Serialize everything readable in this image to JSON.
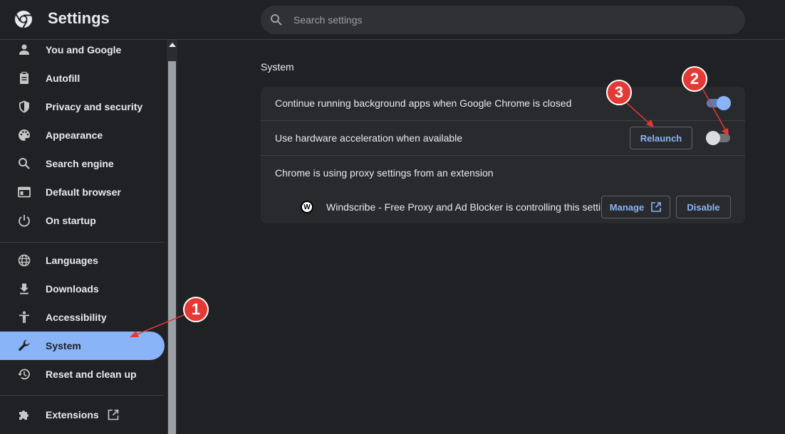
{
  "header": {
    "title": "Settings",
    "search_placeholder": "Search settings"
  },
  "sidebar": {
    "items": [
      {
        "label": "You and Google",
        "icon": "person-icon"
      },
      {
        "label": "Autofill",
        "icon": "clipboard-icon"
      },
      {
        "label": "Privacy and security",
        "icon": "shield-icon"
      },
      {
        "label": "Appearance",
        "icon": "palette-icon"
      },
      {
        "label": "Search engine",
        "icon": "search-icon"
      },
      {
        "label": "Default browser",
        "icon": "browser-icon"
      },
      {
        "label": "On startup",
        "icon": "power-icon"
      },
      {
        "label": "Languages",
        "icon": "globe-icon"
      },
      {
        "label": "Downloads",
        "icon": "download-icon"
      },
      {
        "label": "Accessibility",
        "icon": "accessibility-icon"
      },
      {
        "label": "System",
        "icon": "wrench-icon",
        "active": true
      },
      {
        "label": "Reset and clean up",
        "icon": "restore-icon"
      },
      {
        "label": "Extensions",
        "icon": "puzzle-icon"
      }
    ]
  },
  "main": {
    "section_title": "System",
    "rows": {
      "background_apps": {
        "label": "Continue running background apps when Google Chrome is closed",
        "enabled": true
      },
      "hardware_accel": {
        "label": "Use hardware acceleration when available",
        "enabled": false,
        "button": "Relaunch"
      },
      "proxy": {
        "label": "Chrome is using proxy settings from an extension",
        "extension_text": "Windscribe - Free Proxy and Ad Blocker is controlling this setting",
        "extension_icon_letter": "W",
        "manage_button": "Manage",
        "disable_button": "Disable"
      }
    }
  },
  "callouts": [
    "1",
    "2",
    "3"
  ],
  "colors": {
    "accent": "#8ab4f8",
    "background": "#202124",
    "card": "#292a2d",
    "callout": "#e53935"
  }
}
